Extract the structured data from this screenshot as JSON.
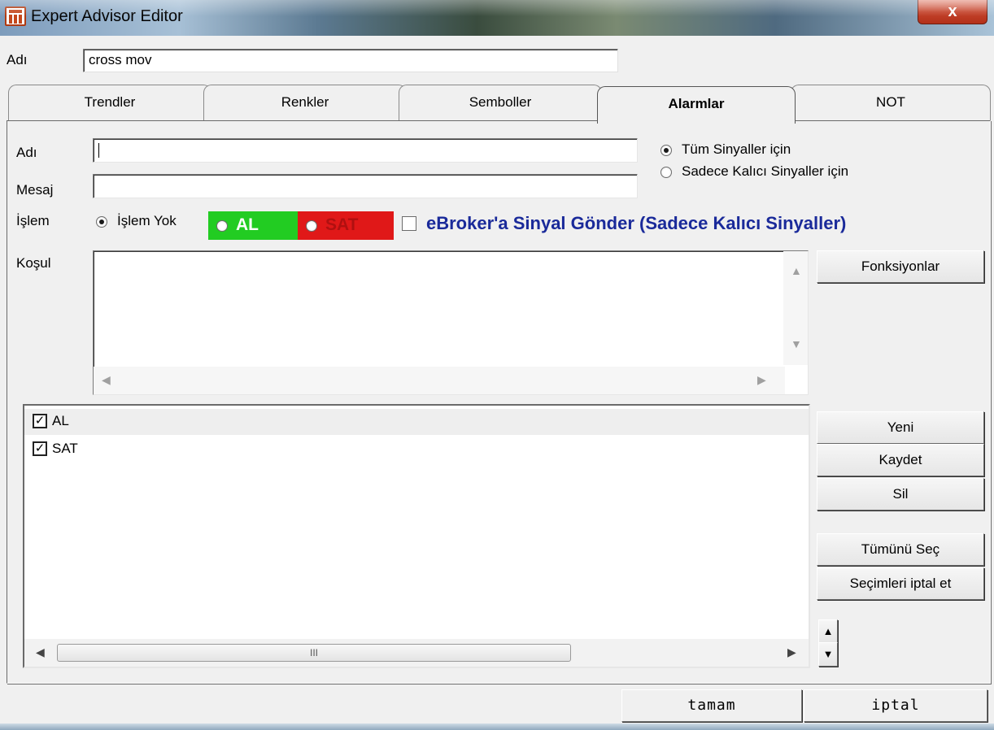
{
  "window": {
    "title": "Expert Advisor Editor",
    "close_glyph": "x"
  },
  "top": {
    "name_label": "Adı",
    "name_value": "cross mov"
  },
  "tabs": [
    {
      "label": "Trendler"
    },
    {
      "label": "Renkler"
    },
    {
      "label": "Semboller"
    },
    {
      "label": "Alarmlar",
      "active": true
    },
    {
      "label": "NOT"
    }
  ],
  "alarm": {
    "name_label": "Adı",
    "name_value": "",
    "message_label": "Mesaj",
    "message_value": "",
    "scope_options": [
      {
        "label": "Tüm Sinyaller için",
        "selected": true
      },
      {
        "label": "Sadece Kalıcı Sinyaller için",
        "selected": false
      }
    ],
    "action_label": "İşlem",
    "action_none": "İşlem Yok",
    "action_buy": "AL",
    "action_sell": "SAT",
    "ebroker_label": "eBroker'a Sinyal Gönder (Sadece Kalıcı Sinyaller)",
    "condition_label": "Koşul",
    "functions_button": "Fonksiyonlar"
  },
  "list": {
    "items": [
      {
        "label": "AL",
        "checked": true
      },
      {
        "label": "SAT",
        "checked": true
      }
    ],
    "scroll_thumb_glyph": "III"
  },
  "side_buttons": {
    "new": "Yeni",
    "save": "Kaydet",
    "delete": "Sil",
    "select_all": "Tümünü Seç",
    "deselect": "Seçimleri iptal et"
  },
  "footer": {
    "ok": "tamam",
    "cancel": "iptal"
  },
  "colors": {
    "buy_bg": "#22cc22",
    "sell_bg": "#e01818",
    "ebroker_text": "#1a2a9a"
  }
}
